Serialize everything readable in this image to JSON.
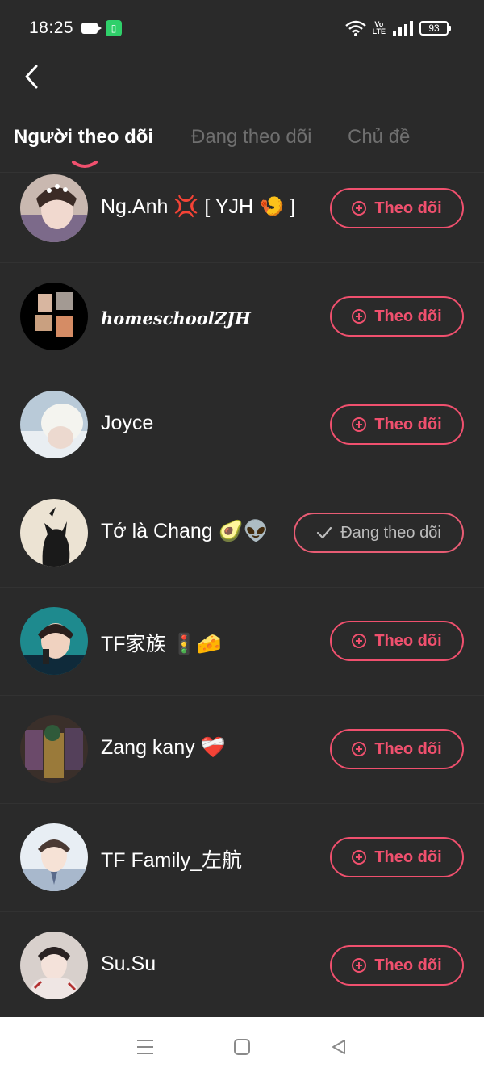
{
  "status_bar": {
    "time": "18:25",
    "battery": "93",
    "volte": "Vo\nLTE"
  },
  "header": {
    "tabs": [
      {
        "label": "Người theo dõi",
        "active": true
      },
      {
        "label": "Đang theo dõi",
        "active": false
      },
      {
        "label": "Chủ đề",
        "active": false
      }
    ]
  },
  "colors": {
    "background": "#2a2a2a",
    "accent": "#f0506e",
    "tab_inactive": "#6f6f6f"
  },
  "followers": [
    {
      "name": "Ng.Anh",
      "emoji_suffix": "💢 [ YJH 🍤 ]",
      "button": "Theo dõi",
      "following": false
    },
    {
      "name": "homeschoolZJH",
      "emoji_suffix": "",
      "button": "Theo dõi",
      "following": false
    },
    {
      "name": "Joyce",
      "emoji_suffix": "",
      "button": "Theo dõi",
      "following": false
    },
    {
      "name": "Tớ là Chang",
      "emoji_suffix": "🥑👽",
      "button": "Đang theo dõi",
      "following": true
    },
    {
      "name": "TF家族",
      "emoji_suffix": "🚦🧀",
      "button": "Theo dõi",
      "following": false
    },
    {
      "name": "Zang kany",
      "emoji_suffix": "❤️‍🩹",
      "button": "Theo dõi",
      "following": false
    },
    {
      "name": "TF Family_左航",
      "emoji_suffix": "",
      "button": "Theo dõi",
      "following": false
    },
    {
      "name": "Su.Su",
      "emoji_suffix": "",
      "button": "Theo dõi",
      "following": false
    }
  ],
  "nav": {
    "icons": [
      "menu-icon",
      "home-square-icon",
      "back-triangle-icon"
    ]
  }
}
